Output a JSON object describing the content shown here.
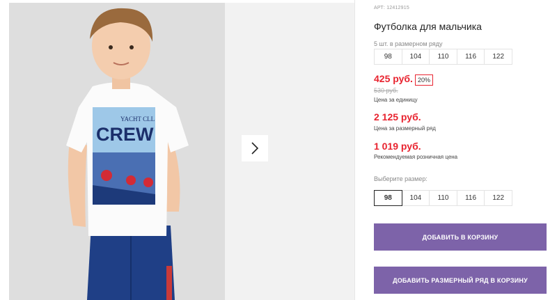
{
  "product": {
    "article": "АРТ: 12412915",
    "title": "Футболка для мальчика",
    "pack_label": "5 шт. в размерном ряду",
    "pack_sizes": [
      "98",
      "104",
      "110",
      "116",
      "122"
    ]
  },
  "pricing": {
    "unit_price": "425 руб.",
    "discount_badge": "20%",
    "old_price": "530 руб.",
    "unit_caption": "Цена за единицу",
    "pack_price": "2 125 руб.",
    "pack_caption": "Цена за размерный ряд",
    "retail_price": "1 019 руб.",
    "retail_caption": "Рекомендуемая розничная цена"
  },
  "size_select": {
    "label": "Выберите размер:",
    "options": [
      "98",
      "104",
      "110",
      "116",
      "122"
    ],
    "selected": "98"
  },
  "buttons": {
    "add_to_cart": "ДОБАВИТЬ В КОРЗИНУ",
    "add_pack_to_cart": "ДОБАВИТЬ РАЗМЕРНЫЙ РЯД В КОРЗИНУ"
  },
  "photo": {
    "shirt_print_text": "CREW",
    "shirt_print_subtext": "YACHT CLL"
  },
  "icons": {
    "next": "chevron-right-icon"
  },
  "colors": {
    "price_red": "#e8232f",
    "button_purple": "#7d63a9"
  }
}
